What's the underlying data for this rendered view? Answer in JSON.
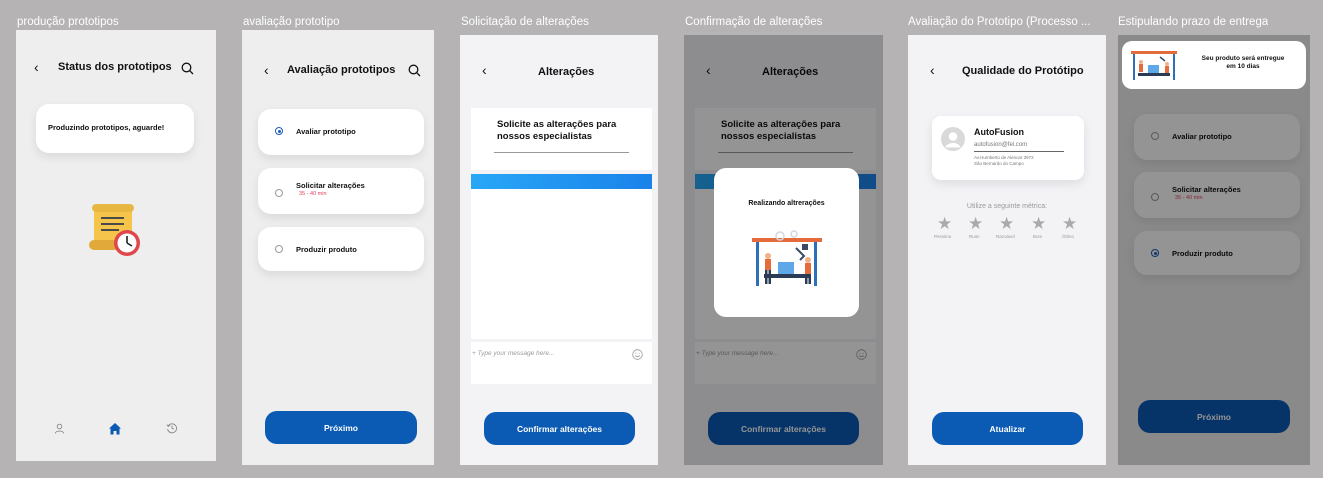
{
  "frames": {
    "f1": {
      "label": "produção prototipos",
      "title": "Status dos prototipos",
      "message": "Produzindo prototipos, aguarde!",
      "nav_icons": [
        "person-icon",
        "home-icon",
        "history-icon"
      ]
    },
    "f2": {
      "label": "avaliação prototipo",
      "title": "Avaliação prototipos",
      "options": [
        {
          "label": "Avaliar prototipo",
          "sub": "",
          "selected": true
        },
        {
          "label": "Solicitar alterações",
          "sub": "35 - 40 min",
          "selected": false
        },
        {
          "label": "Produzir produto",
          "sub": "",
          "selected": false
        }
      ],
      "button": "Próximo"
    },
    "f3": {
      "label": "Solicitação de alterações",
      "title": "Alterações",
      "heading": "Solicite as alterações para nossos especialistas",
      "placeholder": "+ Type your message here...",
      "button": "Confirmar alterações"
    },
    "f4": {
      "label": "Confirmação de alterações",
      "title": "Alterações",
      "heading": "Solicite as alterações para nossos especialistas",
      "placeholder": "+ Type your message here...",
      "button": "Confirmar alterações",
      "modal_text": "Realizando altrerações"
    },
    "f5": {
      "label": "Avaliação do Prototipo (Processo ...",
      "title": "Qualidade do Protótipo",
      "company": "AutoFusion",
      "email": "autofusion@fei.com",
      "address1": "Av.Humberto de Alencar 3972",
      "address2": "São Bernardo do Campo",
      "metric_prompt": "Utilize a seguinte métrica:",
      "ratings": [
        "Pessimo",
        "Ruim",
        "Razoável",
        "Bom",
        "Ótimo"
      ],
      "button": "Atualizar"
    },
    "f6": {
      "label": "Estipulando prazo de entrega",
      "notice_line1": "Seu produto será entregue",
      "notice_line2": "em 10 dias",
      "options": [
        {
          "label": "Avaliar prototipo",
          "sub": "",
          "selected": false
        },
        {
          "label": "Solicitar alterações",
          "sub": "35 - 40 min",
          "selected": false
        },
        {
          "label": "Produzir produto",
          "sub": "",
          "selected": true
        }
      ],
      "button": "Próximo"
    }
  },
  "colors": {
    "canvas": "#b5b3b4",
    "primary_button": "#0b5ab4",
    "accent_bar": "#1a8cf0",
    "subtext_red": "#e2405a"
  }
}
